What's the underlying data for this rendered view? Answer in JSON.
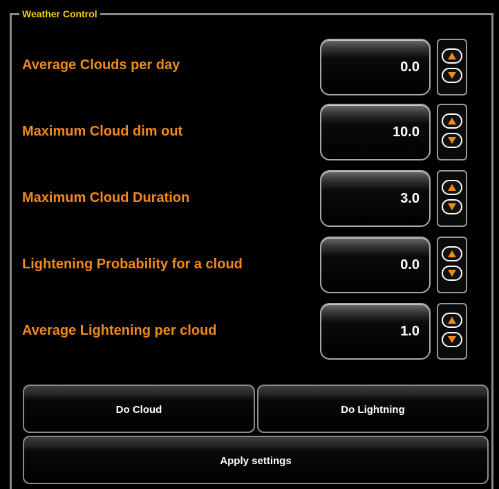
{
  "group": {
    "title": "Weather Control"
  },
  "rows": [
    {
      "label": "Average Clouds per day",
      "value": "0.0"
    },
    {
      "label": "Maximum Cloud dim out",
      "value": "10.0"
    },
    {
      "label": "Maximum Cloud Duration",
      "value": "3.0"
    },
    {
      "label": "Lightening Probability for a cloud",
      "value": "0.0"
    },
    {
      "label": "Average Lightening per cloud",
      "value": "1.0"
    }
  ],
  "buttons": {
    "do_cloud": "Do Cloud",
    "do_lightning": "Do Lightning",
    "apply": "Apply settings"
  },
  "icons": {
    "spin_up": "chevron-up-icon",
    "spin_down": "chevron-down-icon"
  },
  "colors": {
    "background": "#000000",
    "label": "#f08a1c",
    "title": "#ffcc00",
    "spinner_arrow": "#f08a1c",
    "value_text": "#ffffff"
  }
}
